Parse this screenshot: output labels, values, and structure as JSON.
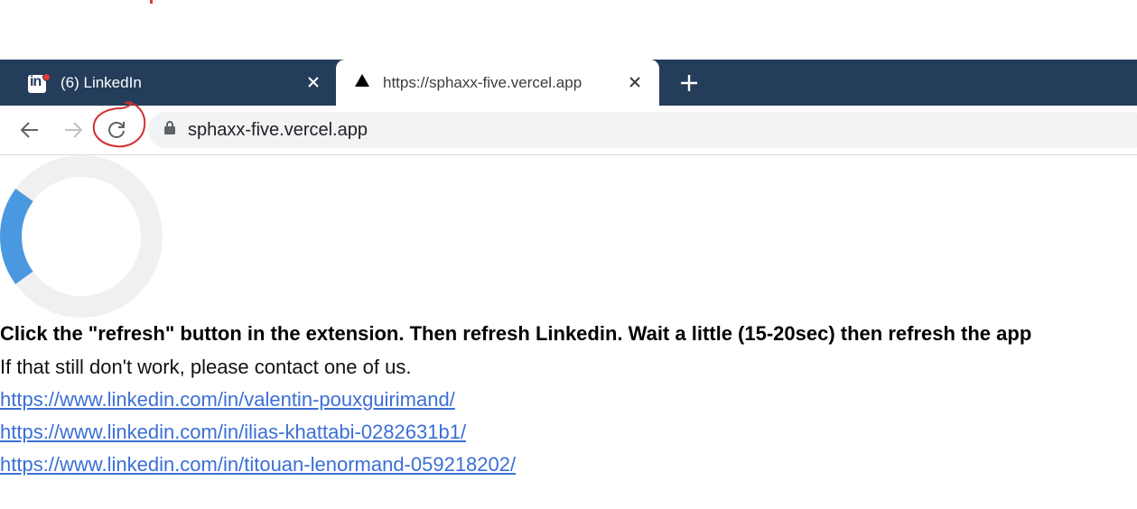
{
  "browser": {
    "tabs": [
      {
        "title": "(6) LinkedIn",
        "icon": "linkedin-icon",
        "active": false
      },
      {
        "title": "https://sphaxx-five.vercel.app",
        "icon": "vercel-triangle-icon",
        "active": true
      }
    ],
    "new_tab_icon": "plus-icon",
    "close_icon": "close-icon",
    "address": "sphaxx-five.vercel.app",
    "lock_icon": "lock-icon",
    "tabbar_color": "#233d5b",
    "annotation_color": "#d32f2f"
  },
  "page": {
    "spinner": {
      "progress": 0.2,
      "track_color": "#f0f0f0",
      "arc_color": "#4a98e0"
    },
    "instruction": "Click the \"refresh\" button in the extension. Then refresh Linkedin. Wait a little (15-20sec) then refresh the app",
    "fallback": "If that still don't work, please contact one of us.",
    "links": [
      "https://www.linkedin.com/in/valentin-pouxguirimand/",
      "https://www.linkedin.com/in/ilias-khattabi-0282631b1/",
      "https://www.linkedin.com/in/titouan-lenormand-059218202/"
    ],
    "link_color": "#3b6fd6"
  }
}
